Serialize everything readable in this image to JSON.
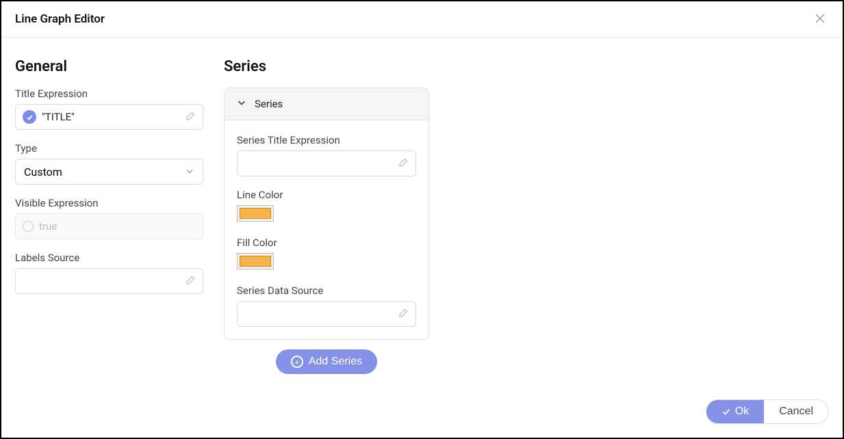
{
  "dialog": {
    "title": "Line Graph Editor"
  },
  "general": {
    "heading": "General",
    "title_expression_label": "Title Expression",
    "title_expression_value": "\"TITLE\"",
    "type_label": "Type",
    "type_value": "Custom",
    "visible_expression_label": "Visible Expression",
    "visible_expression_placeholder": "true",
    "labels_source_label": "Labels Source",
    "labels_source_value": ""
  },
  "series": {
    "heading": "Series",
    "panel_title": "Series",
    "series_title_expression_label": "Series Title Expression",
    "series_title_expression_value": "",
    "line_color_label": "Line Color",
    "line_color_value": "#f5b450",
    "fill_color_label": "Fill Color",
    "fill_color_value": "#f5b450",
    "series_data_source_label": "Series Data Source",
    "series_data_source_value": "",
    "add_series_label": "Add Series"
  },
  "footer": {
    "ok_label": "Ok",
    "cancel_label": "Cancel"
  }
}
